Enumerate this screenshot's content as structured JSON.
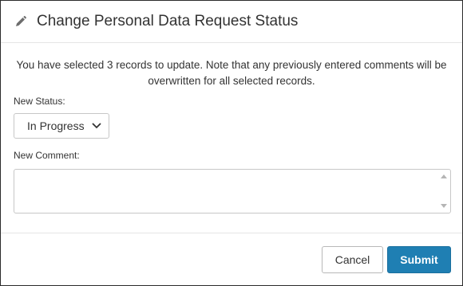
{
  "dialog": {
    "title": "Change Personal Data Request Status",
    "title_icon": "pencil-icon",
    "info_text": "You have selected 3 records to update. Note that any previously entered comments will be overwritten for all selected records.",
    "status_label": "New Status:",
    "status_value": "In Progress",
    "comment_label": "New Comment:",
    "comment_value": "",
    "cancel_label": "Cancel",
    "submit_label": "Submit"
  },
  "colors": {
    "submit_bg": "#1f7fb3",
    "border": "#2b2b2b"
  }
}
